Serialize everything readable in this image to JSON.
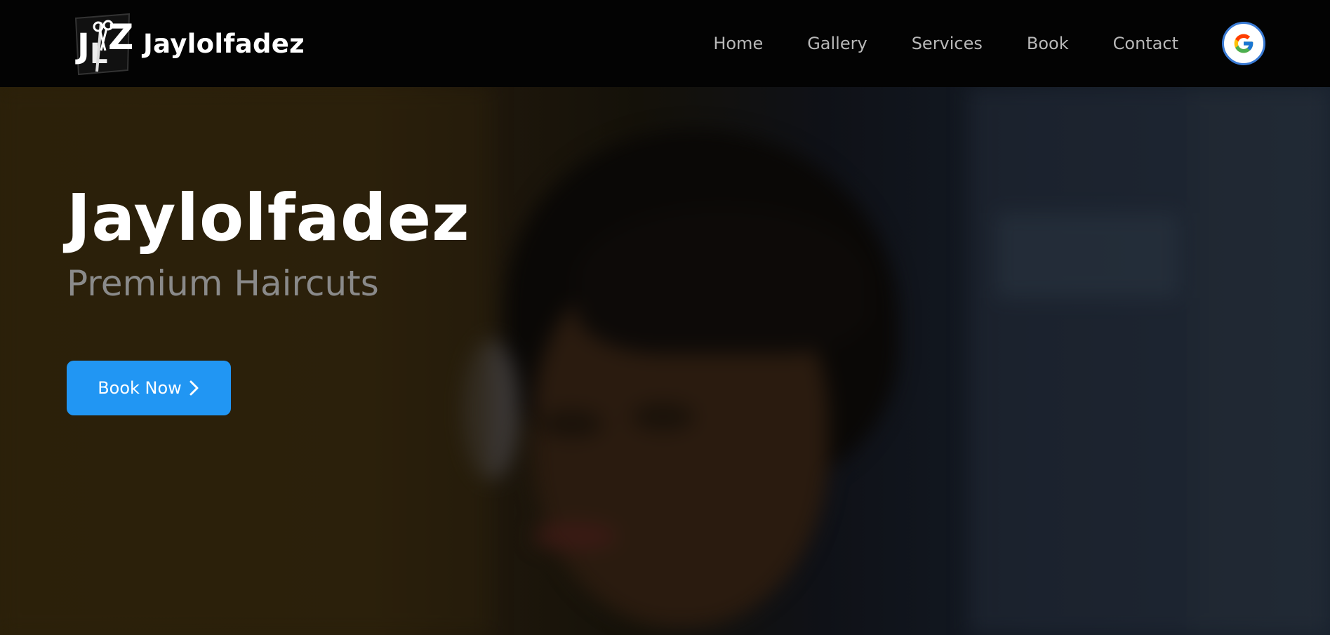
{
  "header": {
    "brand_name": "Jaylolfadez",
    "logo_text": "JLFZ",
    "nav": [
      {
        "label": "Home"
      },
      {
        "label": "Gallery"
      },
      {
        "label": "Services"
      },
      {
        "label": "Book"
      },
      {
        "label": "Contact"
      }
    ],
    "google_icon": "google-g-icon"
  },
  "hero": {
    "title": "Jaylolfadez",
    "subtitle": "Premium Haircuts",
    "cta_label": "Book Now",
    "cta_icon": "chevron-right-icon"
  },
  "colors": {
    "accent": "#2196f3",
    "navbar_bg": "#030303",
    "nav_text": "#b8b8b8",
    "subtitle": "#8a8a8a"
  }
}
